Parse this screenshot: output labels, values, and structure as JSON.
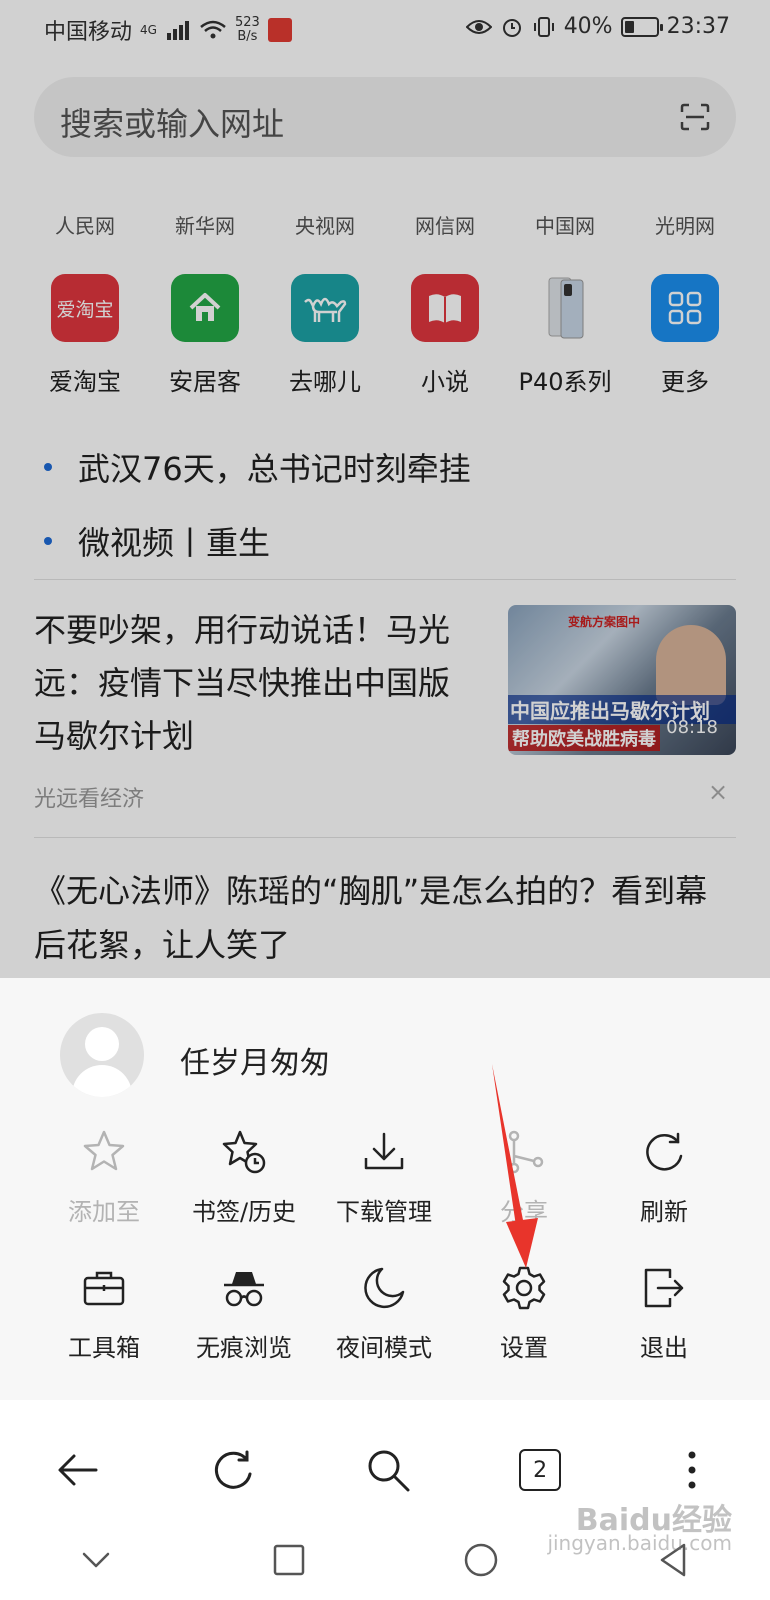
{
  "status_bar": {
    "carrier": "中国移动",
    "network": "4G",
    "net_speed_value": "523",
    "net_speed_unit": "B/s",
    "battery": "40%",
    "battery_fraction": 0.4,
    "time": "23:37"
  },
  "search": {
    "placeholder": "搜索或输入网址"
  },
  "quick_links": [
    "人民网",
    "新华网",
    "央视网",
    "网信网",
    "中国网",
    "光明网"
  ],
  "apps": [
    {
      "label": "爱淘宝",
      "icon_text": "爱淘宝",
      "icon": "taobao-icon",
      "color": "#e0363f"
    },
    {
      "label": "安居客",
      "icon_text": "",
      "icon": "home-icon",
      "color": "#23a846"
    },
    {
      "label": "去哪儿",
      "icon_text": "",
      "icon": "camel-icon",
      "color": "#1da3a6"
    },
    {
      "label": "小说",
      "icon_text": "",
      "icon": "book-icon",
      "color": "#e0363f"
    },
    {
      "label": "P40系列",
      "icon_text": "",
      "icon": "phone-icon",
      "color": "#f2f2f2"
    },
    {
      "label": "更多",
      "icon_text": "",
      "icon": "grid-icon",
      "color": "#1b8ff0"
    }
  ],
  "headlines": [
    "武汉76天，总书记时刻牵挂",
    "微视频丨重生"
  ],
  "articles": [
    {
      "title": "不要吵架，用行动说话！马光远：疫情下当尽快推出中国版马歇尔计划",
      "source": "光远看经济",
      "thumb_top_caption": "变航方案图中",
      "thumb_caption_1": "中国应推出马歇尔计划",
      "thumb_caption_2": "帮助欧美战胜病毒",
      "thumb_duration": "08:18",
      "close_symbol": "×"
    },
    {
      "title": "《无心法师》陈瑶的“胸肌”是怎么拍的？看到幕后花絮，让人笑了"
    }
  ],
  "menu": {
    "username": "任岁月匆匆",
    "row1": [
      {
        "label": "添加至",
        "icon": "star-icon",
        "enabled": false
      },
      {
        "label": "书签/历史",
        "icon": "bookmark-history-icon",
        "enabled": true
      },
      {
        "label": "下载管理",
        "icon": "download-icon",
        "enabled": true
      },
      {
        "label": "分享",
        "icon": "share-icon",
        "enabled": false
      },
      {
        "label": "刷新",
        "icon": "refresh-icon",
        "enabled": true
      }
    ],
    "row2": [
      {
        "label": "工具箱",
        "icon": "toolbox-icon",
        "enabled": true
      },
      {
        "label": "无痕浏览",
        "icon": "incognito-icon",
        "enabled": true
      },
      {
        "label": "夜间模式",
        "icon": "moon-icon",
        "enabled": true
      },
      {
        "label": "设置",
        "icon": "gear-icon",
        "enabled": true
      },
      {
        "label": "退出",
        "icon": "exit-icon",
        "enabled": true
      }
    ]
  },
  "toolbar": {
    "tab_count": "2"
  },
  "watermark": {
    "brand": "Baidu经验",
    "url": "jingyan.baidu.com"
  },
  "colors": {
    "annotation_arrow": "#e8342b",
    "headline_dot": "#1e6bd6",
    "disabled_label": "#b3b3b3"
  }
}
